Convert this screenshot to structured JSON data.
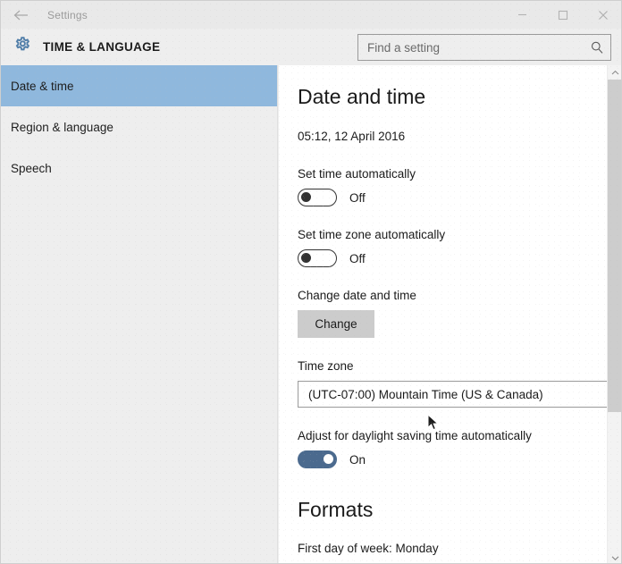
{
  "window": {
    "titlebar": {
      "back_icon": "back-arrow-icon",
      "title": "Settings",
      "minimize_icon": "minimize-icon",
      "maximize_icon": "maximize-icon",
      "close_icon": "close-icon"
    },
    "header": {
      "gear_icon": "gear-icon",
      "title": "TIME & LANGUAGE",
      "search": {
        "placeholder": "Find a setting",
        "value": "",
        "icon": "search-icon"
      }
    }
  },
  "sidebar": {
    "items": [
      {
        "label": "Date & time",
        "selected": true
      },
      {
        "label": "Region & language",
        "selected": false
      },
      {
        "label": "Speech",
        "selected": false
      }
    ]
  },
  "main": {
    "page_title": "Date and time",
    "current_datetime": "05:12, 12 April 2016",
    "set_time_automatically": {
      "label": "Set time automatically",
      "state": "Off",
      "on": false
    },
    "set_timezone_automatically": {
      "label": "Set time zone automatically",
      "state": "Off",
      "on": false
    },
    "change_date_and_time": {
      "label": "Change date and time",
      "button_label": "Change"
    },
    "time_zone": {
      "label": "Time zone",
      "value": "(UTC-07:00) Mountain Time (US & Canada)"
    },
    "daylight_saving": {
      "label": "Adjust for daylight saving time automatically",
      "state": "On",
      "on": true
    },
    "formats": {
      "title": "Formats",
      "first_line": "First day of week: Monday"
    }
  },
  "scrollbar": {
    "up_icon": "chevron-up-icon",
    "down_icon": "chevron-down-icon"
  },
  "colors": {
    "accent_selected": "#8fb8dd",
    "toggle_on": "#4b6a8e",
    "gear_blue": "#4f7da8",
    "sidebar_bg": "#eeeeee",
    "content_bg": "#ffffff"
  }
}
